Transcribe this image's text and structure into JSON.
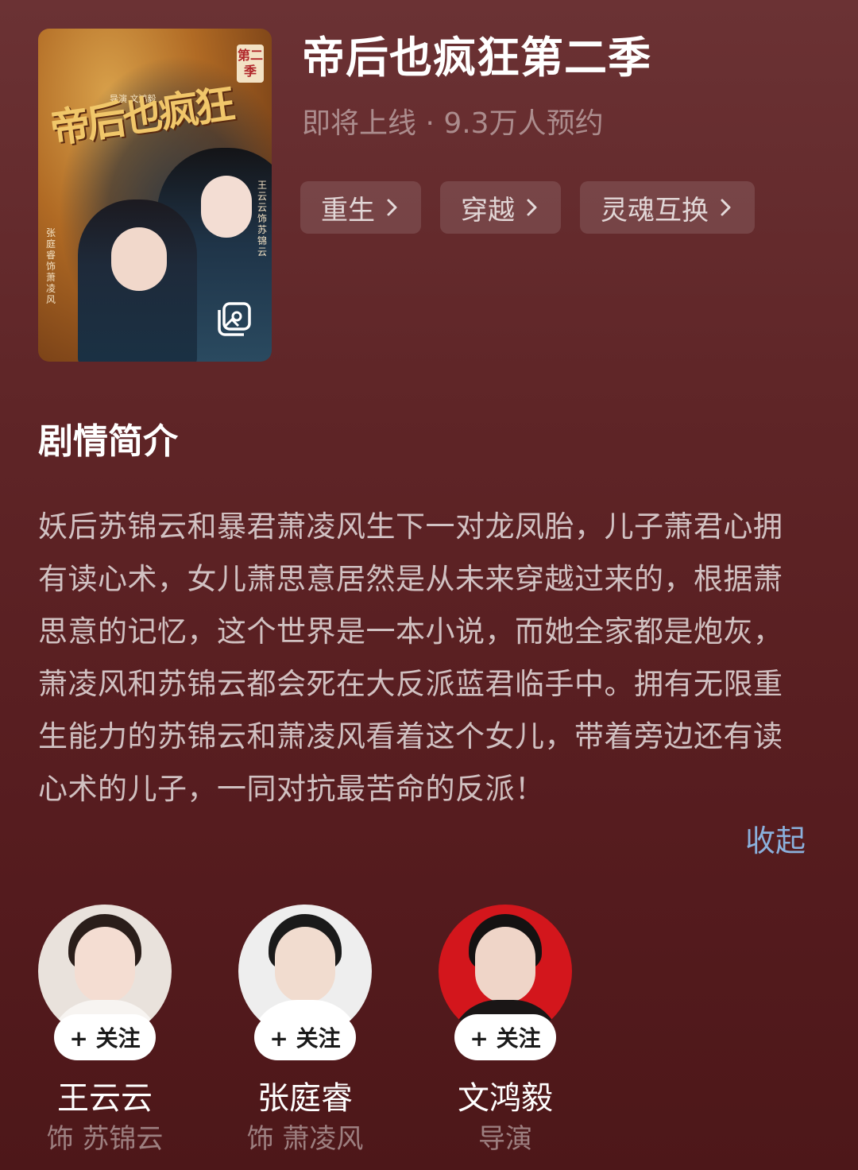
{
  "drama": {
    "title": "帝后也疯狂第二季",
    "status_line": "即将上线 · 9.3万人预约",
    "poster": {
      "title_art": "帝后也疯狂",
      "season_tag": "第二季",
      "credit": "导演 文鸿毅",
      "cast_left": "张庭睿 饰 萧凌风",
      "cast_right": "王云云 饰 苏锦云"
    },
    "tags": [
      {
        "label": "重生"
      },
      {
        "label": "穿越"
      },
      {
        "label": "灵魂互换"
      }
    ]
  },
  "synopsis": {
    "heading": "剧情简介",
    "text": "妖后苏锦云和暴君萧凌风生下一对龙凤胎，儿子萧君心拥有读心术，女儿萧思意居然是从未来穿越过来的，根据萧思意的记忆，这个世界是一本小说，而她全家都是炮灰，萧凌风和苏锦云都会死在大反派蓝君临手中。拥有无限重生能力的苏锦云和萧凌风看着这个女儿，带着旁边还有读心术的儿子，一同对抗最苦命的反派！",
    "collapse_label": "收起"
  },
  "cast": [
    {
      "name": "王云云",
      "role": "饰 苏锦云",
      "follow_label": "+ 关注"
    },
    {
      "name": "张庭睿",
      "role": "饰 萧凌风",
      "follow_label": "+ 关注"
    },
    {
      "name": "文鸿毅",
      "role": "导演",
      "follow_label": "+ 关注"
    }
  ],
  "colors": {
    "background_top": "#6b3234",
    "background_bottom": "#4d1719",
    "link": "#8ab0dc"
  },
  "icons": {
    "poster_gallery": "gallery-icon",
    "tag_arrow": "chevron-right-icon"
  }
}
